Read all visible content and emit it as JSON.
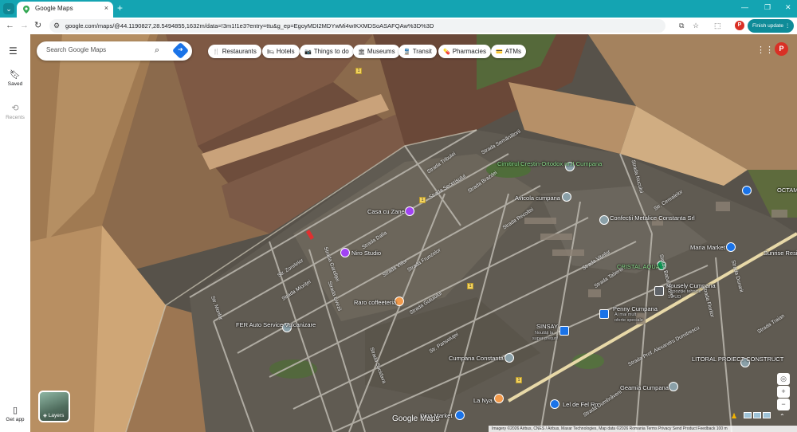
{
  "browser": {
    "tab_title": "Google Maps",
    "tab_close": "×",
    "new_tab": "+",
    "url": "google.com/maps/@44.1190827,28.5494855,1632m/data=!3m1!1e3?entry=ttu&g_ep=EgoyMDI2MDYwMi4wIKXMDSoASAFQAw%3D%3D",
    "profile_initial": "P",
    "finish_update": "Finish update",
    "icons": [
      "back-icon",
      "forward-icon",
      "reload-icon",
      "site-info-icon",
      "install-icon",
      "star-icon",
      "extensions-icon",
      "kebab-menu-icon"
    ]
  },
  "rail": {
    "saved": "Saved",
    "recents": "Recents",
    "get_app": "Get app"
  },
  "search": {
    "placeholder": "Search Google Maps"
  },
  "chips": [
    {
      "label": "Restaurants",
      "icon": "🍴"
    },
    {
      "label": "Hotels",
      "icon": "🛏"
    },
    {
      "label": "Things to do",
      "icon": "📷"
    },
    {
      "label": "Museums",
      "icon": "🏛"
    },
    {
      "label": "Transit",
      "icon": "🚆"
    },
    {
      "label": "Pharmacies",
      "icon": "💊"
    },
    {
      "label": "ATMs",
      "icon": "💳"
    }
  ],
  "account_initial": "P",
  "places": [
    {
      "name": "Cimitirul Creștin-Ortodox nr.II Cumpana",
      "line2": "nr.II Cumpana",
      "color": "#8ee08e"
    },
    {
      "name": "Avicola cumpana",
      "color": "#ffffff"
    },
    {
      "name": "Casa cu Zane",
      "color": "#ffffff"
    },
    {
      "name": "Niro Studio",
      "color": "#ffffff"
    },
    {
      "name": "Confecții Metalice Constanta Srl",
      "line2": "Constanta Srl",
      "color": "#ffffff"
    },
    {
      "name": "Maria Market",
      "color": "#ffffff"
    },
    {
      "name": "CRISTAL AQUA",
      "color": "#8ee08e"
    },
    {
      "name": "Housely Cumpana",
      "color": "#ffffff"
    },
    {
      "name": "Raro coffeeteria",
      "color": "#ffffff"
    },
    {
      "name": "Penny Cumpana",
      "color": "#ffffff"
    },
    {
      "name": "FER Auto Service Vulcanizare",
      "line2": "Vulcanizare",
      "color": "#ffffff"
    },
    {
      "name": "SINSAY",
      "color": "#ffffff"
    },
    {
      "name": "Cumpana Constanta",
      "color": "#ffffff"
    },
    {
      "name": "LITORAL PROIECT CONSTRUCT",
      "color": "#ffffff"
    },
    {
      "name": "Geamia Cumpana",
      "color": "#ffffff"
    },
    {
      "name": "La Nya",
      "color": "#ffffff"
    },
    {
      "name": "Lel de Fel Ro",
      "color": "#ffffff"
    },
    {
      "name": "Dina Market",
      "color": "#ffffff"
    },
    {
      "name": "Sunrise Resie",
      "color": "#ffffff"
    },
    {
      "name": "OCTAM",
      "color": "#ffffff"
    }
  ],
  "sublabels": {
    "housely": "Expoziție tehnice",
    "housely2": "1 PUD",
    "penny": "Ai mai mult",
    "penny2": "oferte speciale",
    "sinsay": "Noutăți la",
    "sinsay2": "super prețuri!"
  },
  "streets": [
    "Strada Tribulei",
    "Strada Semănătorii",
    "Strada Secerișului",
    "Strada Brazdei",
    "Strada Dalia",
    "Str. Zorelelor",
    "Strada Viilor",
    "Strada Frunzelor",
    "Strada Recoltei",
    "Str. Morilor",
    "Strada Mioriței",
    "Strada Garofiței",
    "Strada Livezii",
    "Strada Gutuiului",
    "Str. Panseluței",
    "Strada Sucidava",
    "Strada Vițeilor",
    "Strada Taberei",
    "Strada Baba Novac",
    "Strada Florilor",
    "Strada Dunarii",
    "Strada Ecaterina",
    "Strada Traian",
    "Strada Ovidiu",
    "Str. Cerealelor",
    "Strada Nucului",
    "Strada Ilfov",
    "Str. Gării",
    "Strada Dumbrăveni",
    "Strada Prof. Alexandru Dumitrescu"
  ],
  "route": "1",
  "layers_label": "Layers",
  "logo": "Google Maps",
  "attribution": "Imagery ©2026 Airbus, CNES / Airbus, Maxar Technologies, Map data ©2026    Romania    Terms    Privacy    Send Product Feedback    100 m"
}
